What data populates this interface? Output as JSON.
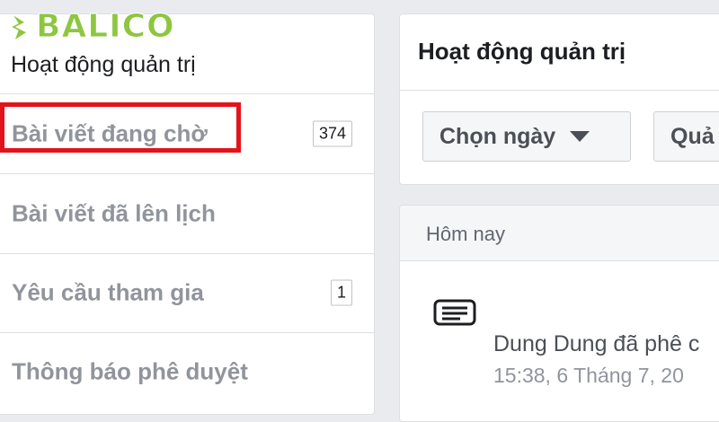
{
  "logo": {
    "text": "BALICO",
    "icon": "balico-logo-icon"
  },
  "sidebar": {
    "title": "Hoạt động quản trị",
    "items": [
      {
        "label": "Bài viết đang chờ",
        "badge": "374",
        "highlighted": true
      },
      {
        "label": "Bài viết đã lên lịch",
        "badge": null
      },
      {
        "label": "Yêu cầu tham gia",
        "badge": "1"
      },
      {
        "label": "Thông báo phê duyệt",
        "badge": null
      }
    ]
  },
  "main": {
    "title": "Hoạt động quản trị",
    "filters": {
      "date_label": "Chọn ngày",
      "second_label": "Quả"
    },
    "activity": {
      "section_label": "Hôm nay",
      "icon": "post-list-icon",
      "text": "Dung Dung đã phê c",
      "time": "15:38, 6 Tháng 7, 20"
    }
  },
  "colors": {
    "background": "#e9ebee",
    "highlight": "#e3131b",
    "logo": "#8dc63f"
  }
}
